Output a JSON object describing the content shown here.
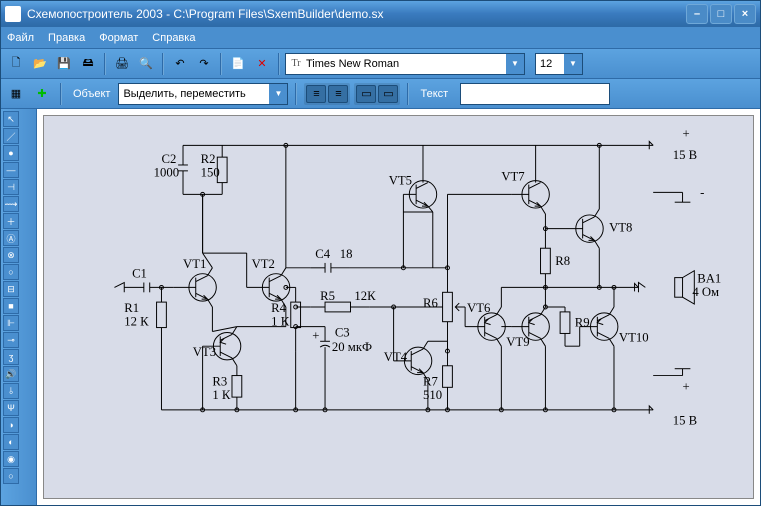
{
  "window": {
    "title": "Схемопостроитель 2003 - C:\\Program Files\\SxemBuilder\\demo.sx"
  },
  "menu": {
    "file": "Файл",
    "edit": "Правка",
    "format": "Формат",
    "help": "Справка"
  },
  "toolbar": {
    "font_prefix": "Tr",
    "font": "Times New Roman",
    "size": "12",
    "object_label": "Объект",
    "object_value": "Выделить, переместить",
    "text_label": "Текст"
  },
  "icons": {
    "new": "🗋",
    "open": "📂",
    "save": "💾",
    "saveall": "🖴",
    "print": "🖨",
    "preview": "🔍",
    "undo": "↶",
    "redo": "↷",
    "copy": "📄",
    "delete": "✕",
    "grid": "▦",
    "plus": "✚",
    "al1": "≡",
    "al2": "≡",
    "al3": "▭",
    "al4": "▭"
  },
  "palette": [
    "↖",
    "／",
    "●",
    "—",
    "⊣",
    "⟿",
    "＋",
    "Ⓐ",
    "⊗",
    "○",
    "⊟",
    "■",
    "⊩",
    "⊸",
    "ʒ",
    "🔊",
    "⫰",
    "Ψ",
    "◑",
    "◐",
    "◉",
    "○"
  ],
  "schematic": {
    "rails": {
      "plus": "+",
      "v15_top": "15 В",
      "minus": "-",
      "v15_bot": "15 В"
    },
    "c2": {
      "ref": "C2",
      "val": "1000"
    },
    "r2": {
      "ref": "R2",
      "val": "150"
    },
    "vt5": "VT5",
    "vt7": "VT7",
    "vt8": "VT8",
    "c1": "C1",
    "vt1": "VT1",
    "vt2": "VT2",
    "c4": {
      "ref": "C4",
      "val": "18"
    },
    "r8": "R8",
    "ba1": {
      "ref": "BA1",
      "val": "4 Ом"
    },
    "r1": {
      "ref": "R1",
      "val": "12 К"
    },
    "vt3": "VT3",
    "r4": {
      "ref": "R4",
      "val": "1 К"
    },
    "r5": {
      "ref": "R5",
      "val": "12К"
    },
    "c3": {
      "ref": "C3",
      "val": "20 мкФ"
    },
    "r6": "R6",
    "vt4": "VT4",
    "vt6": "VT6",
    "vt9": "VT9",
    "r9": "R9",
    "vt10": "VT10",
    "r3": {
      "ref": "R3",
      "val": "1 К"
    },
    "r7": {
      "ref": "R7",
      "val": "510"
    }
  }
}
